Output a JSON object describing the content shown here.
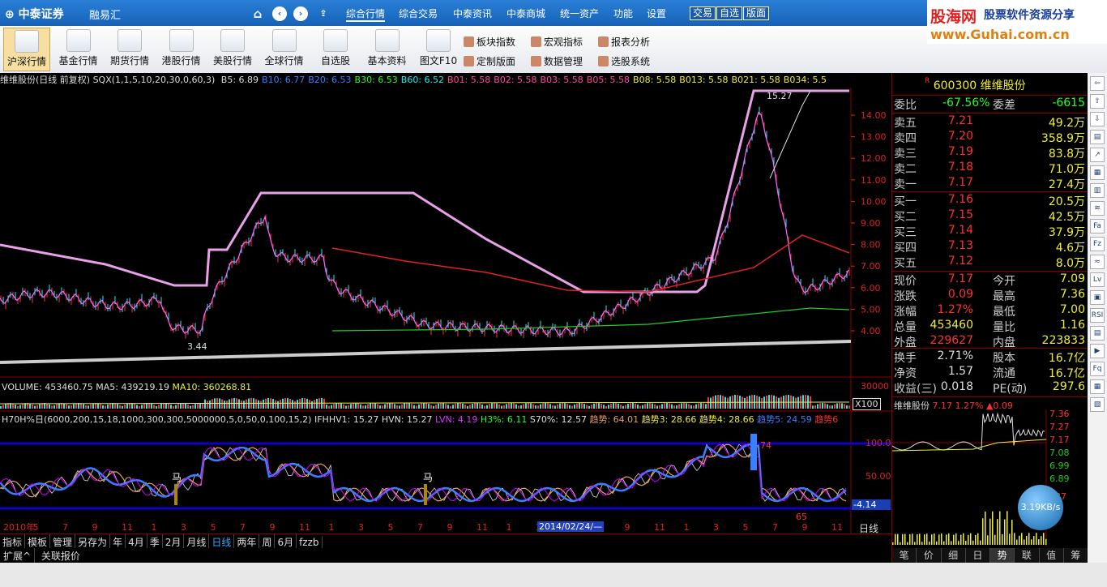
{
  "titlebar": {
    "logo": "⊕ 中泰证券",
    "app": "融易汇",
    "menu": [
      "综合行情",
      "综合交易",
      "中泰资讯",
      "中泰商城",
      "统一资产",
      "功能",
      "设置"
    ],
    "buttons": [
      "交易",
      "自选",
      "版面"
    ]
  },
  "watermark": {
    "line1": "股海网",
    "line2": "股票软件资源分享",
    "url": "www.Guhai.com.cn"
  },
  "toolbar": {
    "items": [
      "沪深行情",
      "基金行情",
      "期货行情",
      "港股行情",
      "美股行情",
      "全球行情",
      "自选股",
      "基本资料",
      "图文F10"
    ],
    "right": [
      "板块指数",
      "宏观指标",
      "报表分析",
      "定制版面",
      "数据管理",
      "选股系统"
    ]
  },
  "chart": {
    "header": "维维股份(日线 前复权) SQX(1,1,5,10,20,30,0,60,3)",
    "ma": [
      {
        "t": "B5: 6.89",
        "c": "#ddd"
      },
      {
        "t": "B10: 6.77",
        "c": "#3a7fff"
      },
      {
        "t": "B20: 6.53",
        "c": "#3a7fff"
      },
      {
        "t": "B30: 6.53",
        "c": "#2f2"
      },
      {
        "t": "B60: 6.52",
        "c": "#2ee"
      },
      {
        "t": "B01: 5.58",
        "c": "#ff4aa0"
      },
      {
        "t": "B02: 5.58",
        "c": "#ff4aa0"
      },
      {
        "t": "B03: 5.58",
        "c": "#ff4aa0"
      },
      {
        "t": "B05: 5.58",
        "c": "#ff4aa0"
      },
      {
        "t": "B08: 5.58",
        "c": "#ee3"
      },
      {
        "t": "B013: 5.58",
        "c": "#ee3"
      },
      {
        "t": "B021: 5.58",
        "c": "#ee3"
      },
      {
        "t": "B034: 5.5",
        "c": "#ee3"
      }
    ],
    "yaxis": [
      "14.00",
      "13.00",
      "12.00",
      "11.00",
      "10.00",
      "9.00",
      "8.00",
      "7.00",
      "6.00",
      "5.00",
      "4.00"
    ],
    "high_label": "15.27",
    "low_label": "3.44",
    "volume": {
      "header": "VOLUME: 453460.75",
      "ma5": "MA5: 439219.19",
      "ma10": "MA10: 360268.81",
      "axis": "30000",
      "unit": "X100"
    },
    "indicator": {
      "header": "H70H%日(6000,200,15,18,1000,300,300,5000000,5,0,50,0,100,15,2)",
      "ifhhv": "IFHHV1: 15.27",
      "hvn": "HVN: 15.27",
      "lvn": "LVN: 4.19",
      "h": "H3%: 6.11",
      "s": "S70%: 12.57",
      "t1": "趋势: 64.01",
      "t2": "趋势3: 28.66",
      "t3": "趋势4: 28.66",
      "t4": "趋势5: 24.59",
      "t5": "趋势6",
      "axis": [
        "100.0",
        "50.00",
        "-4.14"
      ],
      "marks": [
        "马",
        "马"
      ],
      "lowv": "65",
      "peak": "74"
    },
    "xaxis": [
      "2010年",
      "5",
      "7",
      "9",
      "11",
      "1",
      "3",
      "5",
      "7",
      "9",
      "11",
      "1",
      "3",
      "5",
      "7",
      "9",
      "11",
      "1",
      "3",
      "5",
      "7",
      "9",
      "11",
      "1",
      "3",
      "5",
      "7",
      "9",
      "11"
    ],
    "cursor_date": "2014/02/24/—",
    "period": "日线"
  },
  "bottombar": [
    "指标",
    "模板",
    "管理",
    "另存为",
    "年",
    "4月",
    "季",
    "2月",
    "月线",
    "日线",
    "两年",
    "周",
    "6月",
    "fzzb"
  ],
  "bottombar2": [
    "扩展^",
    "关联报价"
  ],
  "quote": {
    "code": "600300",
    "name": "维维股份",
    "webi": {
      "l": "委比",
      "v": "-67.56%",
      "l2": "委差",
      "v2": "-6615"
    },
    "sell": [
      {
        "l": "卖五",
        "p": "7.21",
        "v": "49.2万"
      },
      {
        "l": "卖四",
        "p": "7.20",
        "v": "358.9万"
      },
      {
        "l": "卖三",
        "p": "7.19",
        "v": "83.8万"
      },
      {
        "l": "卖二",
        "p": "7.18",
        "v": "71.0万"
      },
      {
        "l": "卖一",
        "p": "7.17",
        "v": "27.4万"
      }
    ],
    "buy": [
      {
        "l": "买一",
        "p": "7.16",
        "v": "20.5万"
      },
      {
        "l": "买二",
        "p": "7.15",
        "v": "42.5万"
      },
      {
        "l": "买三",
        "p": "7.14",
        "v": "37.9万"
      },
      {
        "l": "买四",
        "p": "7.13",
        "v": "4.6万"
      },
      {
        "l": "买五",
        "p": "7.12",
        "v": "8.0万"
      }
    ],
    "stats": [
      {
        "l": "现价",
        "v": "7.17",
        "c": "red",
        "l2": "今开",
        "v2": "7.09",
        "c2": "red"
      },
      {
        "l": "涨跌",
        "v": "0.09",
        "c": "red",
        "l2": "最高",
        "v2": "7.36",
        "c2": "red"
      },
      {
        "l": "涨幅",
        "v": "1.27%",
        "c": "red",
        "l2": "最低",
        "v2": "7.00",
        "c2": "yellow"
      },
      {
        "l": "总量",
        "v": "453460",
        "c": "yellow",
        "l2": "量比",
        "v2": "1.16",
        "c2": "red"
      },
      {
        "l": "外盘",
        "v": "229627",
        "c": "red",
        "l2": "内盘",
        "v2": "223833",
        "c2": "green"
      }
    ],
    "stats2": [
      {
        "l": "换手",
        "v": "2.71%",
        "l2": "股本",
        "v2": "16.7亿"
      },
      {
        "l": "净资",
        "v": "1.57",
        "l2": "流通",
        "v2": "16.7亿"
      },
      {
        "l": "收益(三)",
        "v": "0.018",
        "l2": "PE(动)",
        "v2": "297.6"
      }
    ],
    "mini": {
      "title": "维维股份",
      "price": "7.17",
      "pct": "1.27%",
      "chg": "▲0.09",
      "axis": [
        "7.36",
        "7.27",
        "7.17",
        "7.08",
        "6.99",
        "6.89",
        "387",
        "93"
      ]
    },
    "tabs": [
      "笔",
      "价",
      "细",
      "日",
      "势",
      "联",
      "值",
      "筹"
    ]
  },
  "speed": "3.19KB/s"
}
